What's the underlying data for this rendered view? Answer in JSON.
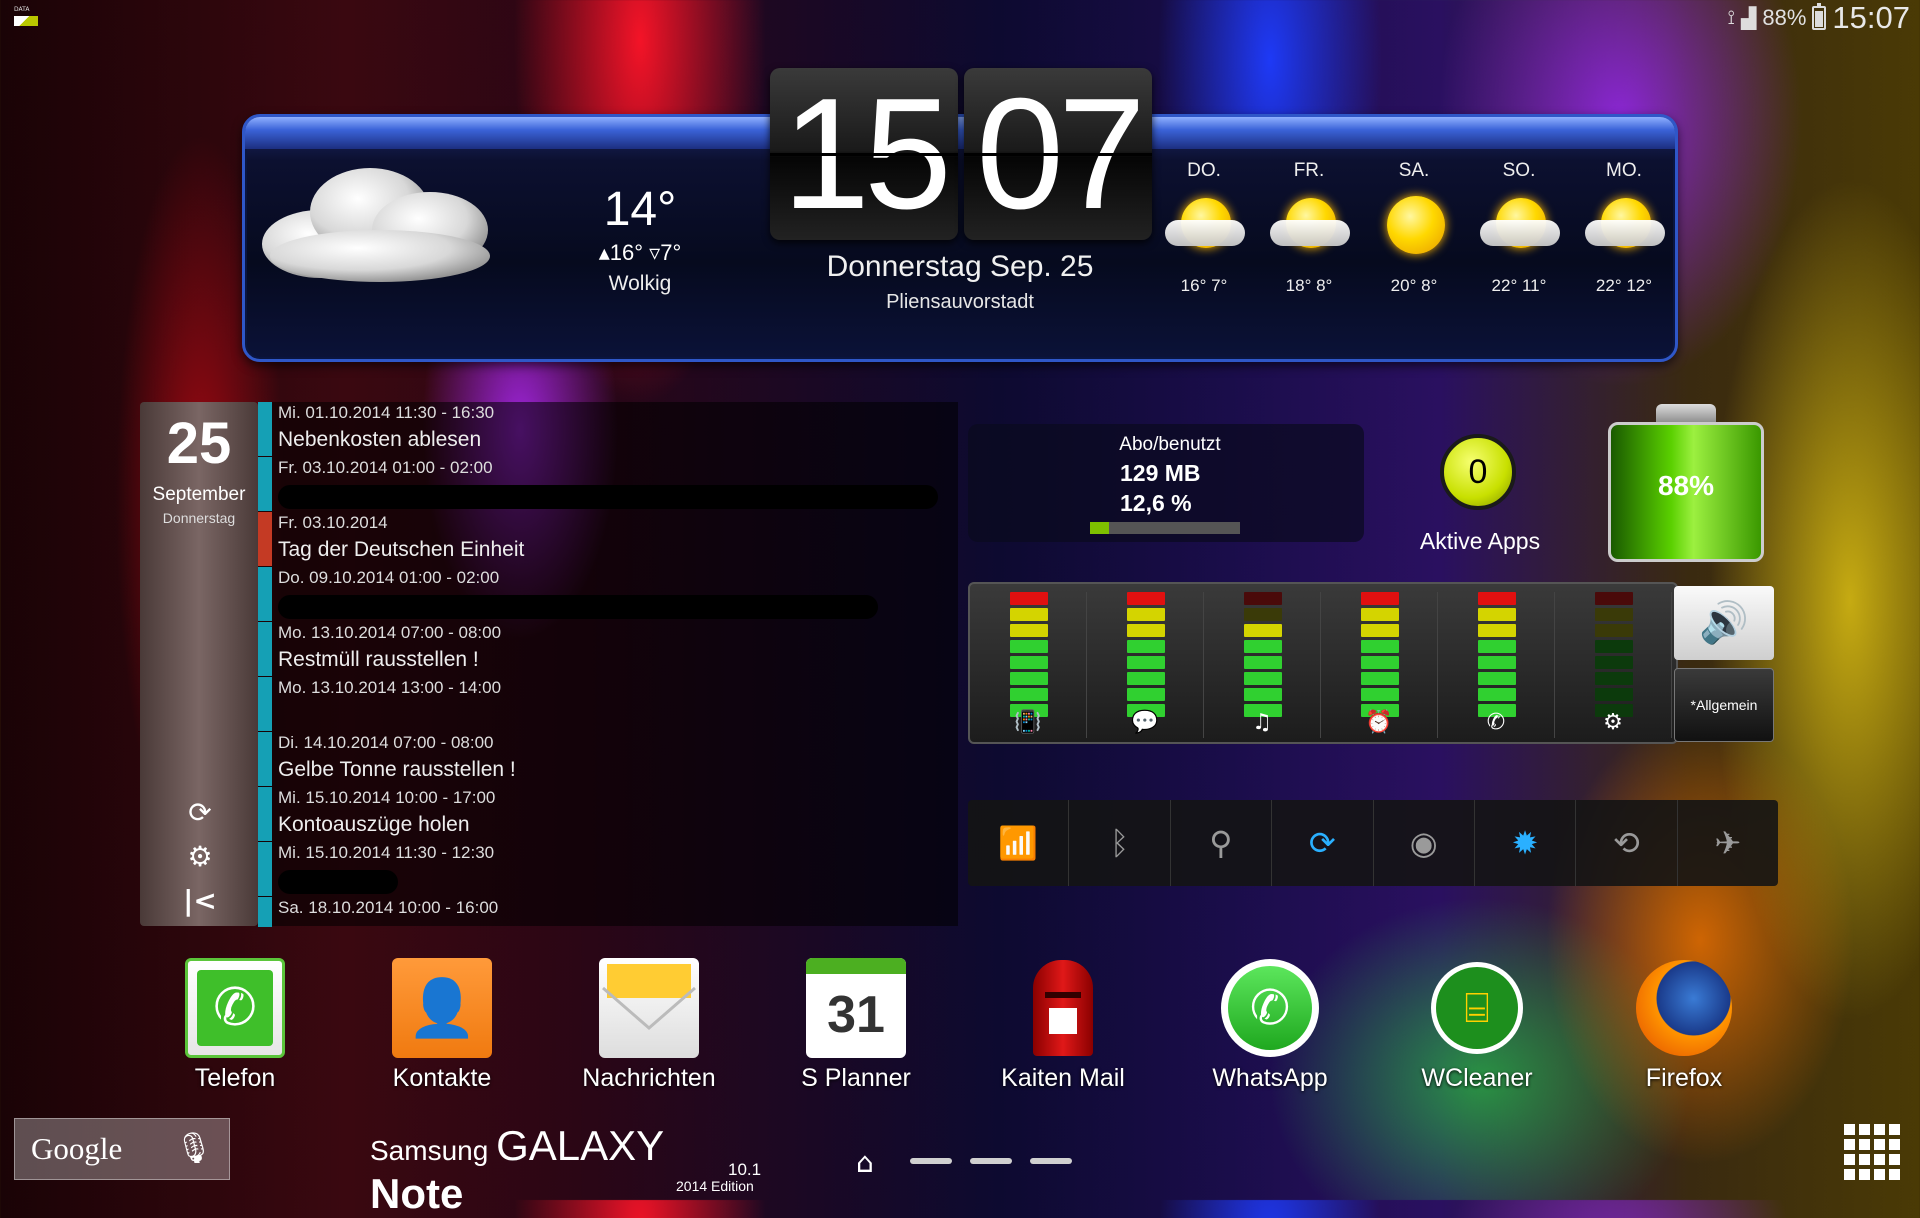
{
  "status_bar": {
    "data_label": "DATA",
    "battery_percent": "88%",
    "time": "15:07"
  },
  "weather": {
    "current_temp": "14°",
    "high_low": "▴16° ▿7°",
    "condition": "Wolkig",
    "clock_hour": "15",
    "clock_minute": "07",
    "date": "Donnerstag Sep. 25",
    "location": "Pliensauvorstadt",
    "forecast": [
      {
        "day": "DO.",
        "temps": "16°  7°",
        "icon": "sun-cloud-icon"
      },
      {
        "day": "FR.",
        "temps": "18°  8°",
        "icon": "sun-cloud-icon"
      },
      {
        "day": "SA.",
        "temps": "20°  8°",
        "icon": "sun-icon"
      },
      {
        "day": "SO.",
        "temps": "22°  11°",
        "icon": "sun-cloud-icon"
      },
      {
        "day": "MO.",
        "temps": "22°  12°",
        "icon": "sun-cloud-icon"
      }
    ]
  },
  "calendar": {
    "day": "25",
    "month": "September",
    "weekday": "Donnerstag",
    "events": [
      {
        "when": "Mi. 01.10.2014 11:30 - 16:30",
        "what": "Nebenkosten ablesen"
      },
      {
        "when": "Fr. 03.10.2014 01:00 - 02:00",
        "what": ""
      },
      {
        "when": "Fr. 03.10.2014",
        "what": "Tag der Deutschen Einheit"
      },
      {
        "when": "Do. 09.10.2014 01:00 - 02:00",
        "what": ""
      },
      {
        "when": "Mo. 13.10.2014 07:00 - 08:00",
        "what": "Restmüll rausstellen !"
      },
      {
        "when": "Mo. 13.10.2014 13:00 - 14:00",
        "what": ""
      },
      {
        "when": "Di. 14.10.2014 07:00 - 08:00",
        "what": "Gelbe Tonne rausstellen !"
      },
      {
        "when": "Mi. 15.10.2014 10:00 - 17:00",
        "what": "Kontoauszüge holen"
      },
      {
        "when": "Mi. 15.10.2014 11:30 - 12:30",
        "what": ""
      },
      {
        "when": "Sa. 18.10.2014 10:00 - 16:00",
        "what": ""
      }
    ]
  },
  "data_usage": {
    "label": "Abo/benutzt",
    "amount": "129 MB",
    "percent": "12,6 %",
    "percent_value": 12.6
  },
  "active_apps": {
    "count": "0",
    "label": "Aktive Apps"
  },
  "battery_widget": {
    "percent": "88%"
  },
  "volume_mixer": {
    "profile_label": "*Allgemein",
    "channels": [
      {
        "icon": "ringtone-icon",
        "level": 7
      },
      {
        "icon": "notification-icon",
        "level": 7
      },
      {
        "icon": "music-icon",
        "level": 6
      },
      {
        "icon": "alarm-icon",
        "level": 7
      },
      {
        "icon": "call-icon",
        "level": 7
      },
      {
        "icon": "system-icon",
        "level": 0
      }
    ]
  },
  "toggles": [
    {
      "icon": "wifi-icon",
      "on": true
    },
    {
      "icon": "bluetooth-icon",
      "on": false
    },
    {
      "icon": "location-icon",
      "on": false
    },
    {
      "icon": "sync-icon",
      "on": true
    },
    {
      "icon": "eye-icon",
      "on": false
    },
    {
      "icon": "brightness-icon",
      "on": true
    },
    {
      "icon": "rotate-icon",
      "on": false
    },
    {
      "icon": "airplane-icon",
      "on": false
    }
  ],
  "dock": [
    {
      "name": "Telefon",
      "icon": "phone-icon"
    },
    {
      "name": "Kontakte",
      "icon": "contacts-icon"
    },
    {
      "name": "Nachrichten",
      "icon": "messages-icon"
    },
    {
      "name": "S Planner",
      "icon": "calendar-icon",
      "badge": "31"
    },
    {
      "name": "Kaiten Mail",
      "icon": "mailbox-icon"
    },
    {
      "name": "WhatsApp",
      "icon": "whatsapp-icon"
    },
    {
      "name": "WCleaner",
      "icon": "wcleaner-icon"
    },
    {
      "name": "Firefox",
      "icon": "firefox-icon"
    }
  ],
  "bottom": {
    "search_label": "Google",
    "brand_1": "Samsung ",
    "brand_2": "GALAXY ",
    "brand_3": "Note",
    "brand_model": "10.1",
    "brand_edition": "2014 Edition"
  },
  "colors": {
    "accent_blue": "#2ab0ff",
    "calendar_strip": "#15a0b5",
    "calendar_holiday_strip": "#c43a24"
  }
}
